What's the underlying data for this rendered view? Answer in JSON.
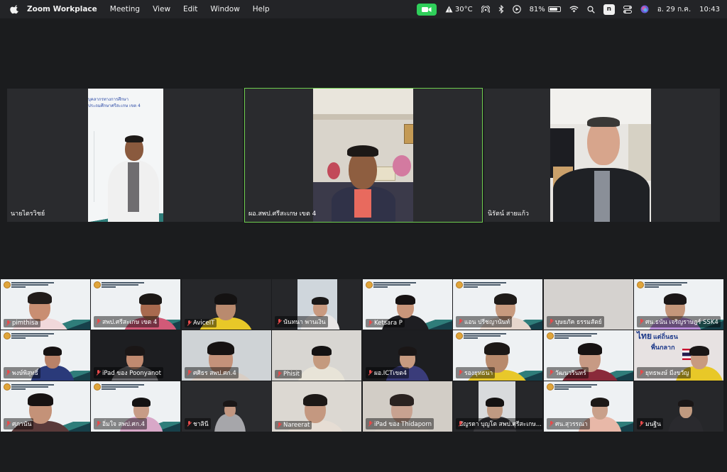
{
  "menubar": {
    "app_name": "Zoom Workplace",
    "items": [
      "Meeting",
      "View",
      "Edit",
      "Window",
      "Help"
    ],
    "status": {
      "temperature": "30°C",
      "battery": "81%",
      "battery_level": 0.81,
      "input_badge": "n",
      "date": "อ. 29 ก.ค.",
      "time": "10:43"
    }
  },
  "speakers": [
    {
      "name": "นายไตรวิชย์",
      "active": false
    },
    {
      "name": "ผอ.สพป.ศรีสะเกษ เขต 4",
      "active": true
    },
    {
      "name": "นิรัตน์  สายแก้ว",
      "active": false
    }
  ],
  "slide": {
    "line1": "บุคลากรทางการศึกษา",
    "line2": "ประถมศึกษาศรีสะเกษ เขต 4"
  },
  "gallery": [
    {
      "name": "pimthisa",
      "muted": true
    },
    {
      "name": "สพป.ศรีสะเกษ เขต 4",
      "muted": true
    },
    {
      "name": "AviceIT",
      "muted": true
    },
    {
      "name": "นันทนา พานเงิน",
      "muted": true
    },
    {
      "name": "Ketsara P",
      "muted": true
    },
    {
      "name": "แอน ปรีชญานันท์",
      "muted": true
    },
    {
      "name": "บุษยภัค ธรรมสัตย์",
      "muted": true
    },
    {
      "name": "ศน.ธนัน เจริญราษฎร์ SSK4",
      "muted": true
    },
    {
      "name": "พงษ์พิสุทธิ์",
      "muted": true
    },
    {
      "name": "iPad ของ Poonyanot",
      "muted": true
    },
    {
      "name": "ศศิธร สพป.ศก.4",
      "muted": true
    },
    {
      "name": "Phisit",
      "muted": true
    },
    {
      "name": "ผอ.ICTเขต4",
      "muted": true
    },
    {
      "name": "รองยุทธนา",
      "muted": true
    },
    {
      "name": "วัฒนวรินทร์",
      "muted": true
    },
    {
      "name": "ยุทธพงษ์ มีงขวัญ",
      "muted": true
    },
    {
      "name": "ศุภานัน",
      "muted": true
    },
    {
      "name": "อิ่มใจ สพป.ศก.4",
      "muted": true
    },
    {
      "name": "ชาลินี",
      "muted": true
    },
    {
      "name": "Nareerat",
      "muted": true
    },
    {
      "name": "iPad ของ Thidaporn",
      "muted": true
    },
    {
      "name": "ธัญรดา บุญโต สพป.ศรีสะเกษ...",
      "muted": true
    },
    {
      "name": "ศน.สุวรรณา",
      "muted": true
    },
    {
      "name": "มนฐิน",
      "muted": true
    }
  ],
  "banner_text": {
    "line1": "ไทย",
    "line2": "แต่ถิ่นธน",
    "line3": "พื่นกลาก"
  },
  "colors": {
    "active_border": "#6fcf4f",
    "camera_on": "#2fcf5a",
    "mute": "#e84a4a"
  }
}
